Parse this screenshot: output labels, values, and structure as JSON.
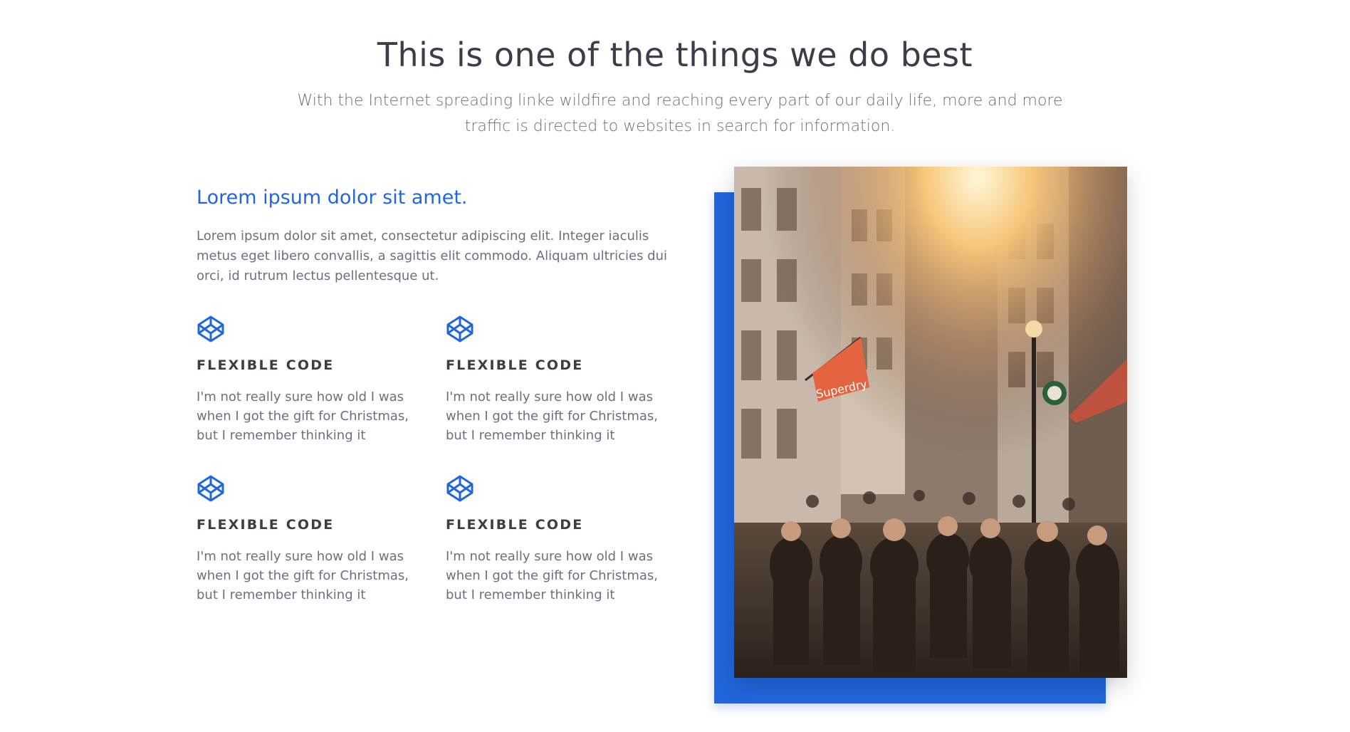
{
  "section": {
    "title": "This is one of the things we do best",
    "subtitle": "With the Internet spreading linke wildfire and reaching every part of our daily life, more and more traffic is directed to websites in search for information."
  },
  "feature": {
    "heading": "Lorem ipsum dolor sit amet.",
    "intro": "Lorem ipsum dolor sit amet, consectetur adipiscing elit. Integer iaculis metus eget libero convallis, a sagittis elit commodo. Aliquam ultricies dui orci, id rutrum lectus pellentesque ut.",
    "cards": [
      {
        "icon": "codepen-icon",
        "title": "FLEXIBLE CODE",
        "text": "I'm not really sure how old I was when I got the gift for Christmas, but I remember thinking it"
      },
      {
        "icon": "codepen-icon",
        "title": "FLEXIBLE CODE",
        "text": "I'm not really sure how old I was when I got the gift for Christmas, but I remember thinking it"
      },
      {
        "icon": "codepen-icon",
        "title": "FLEXIBLE CODE",
        "text": "I'm not really sure how old I was when I got the gift for Christmas, but I remember thinking it"
      },
      {
        "icon": "codepen-icon",
        "title": "FLEXIBLE CODE",
        "text": "I'm not really sure how old I was when I got the gift for Christmas, but I remember thinking it"
      }
    ]
  },
  "image": {
    "signs": [
      "Superdry"
    ]
  },
  "colors": {
    "accent": "#2266dd",
    "title": "#3a3d4a",
    "body": "#6b7080"
  }
}
